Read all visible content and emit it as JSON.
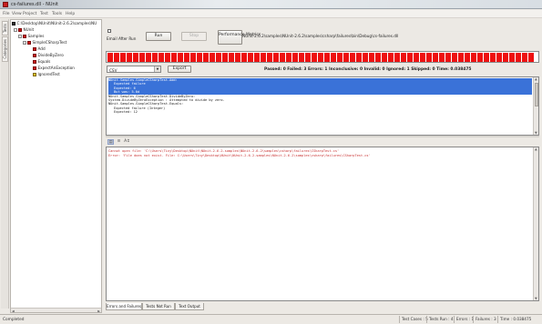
{
  "window": {
    "title": "cs-failures.dll - NUnit"
  },
  "menu": [
    "File",
    "View",
    "Project",
    "Test",
    "Tools",
    "Help"
  ],
  "side_tabs": [
    "Tests",
    "Categories"
  ],
  "tree": {
    "items": [
      {
        "label": "C:\\Desktop\\NUnit\\NUnit-2.6.2\\samples\\NU",
        "expander": ""
      },
      {
        "label": "NUnit",
        "expander": "-"
      },
      {
        "label": "Samples",
        "expander": "-"
      },
      {
        "label": "SimpleCSharpTest",
        "expander": "-"
      },
      {
        "label": "Add",
        "expander": ""
      },
      {
        "label": "DivideByZero",
        "expander": ""
      },
      {
        "label": "Equals",
        "expander": ""
      },
      {
        "label": "ExpectAnException",
        "expander": ""
      },
      {
        "label": "IgnoredTest",
        "expander": ""
      }
    ]
  },
  "controls": {
    "email_after_run": "Email After Run",
    "run_label": "Run",
    "stop_label": "Stop",
    "performance_label": "Performance Metrics",
    "path": "NUnit-2.6.2\\samples\\NUnit-2.6.2\\samples\\csharp\\failures\\bin\\Debug\\cs-failures.dll"
  },
  "format": {
    "selected": "CSV",
    "export_label": "Export"
  },
  "summary": "Passed: 0  Failed: 3  Errors: 1  Inconclusive: 0  Invalid: 0  Ignored: 1  Skipped: 0  Time: 0.038475",
  "results": [
    "NUnit.Samples.SimpleCSharpTest.Add:",
    "  Expected failure",
    "  Expected: 6",
    "  But was:  5.0d",
    "NUnit.Samples.SimpleCSharpTest.DivideByZero:",
    "System.DivideByZeroException : Attempted to divide by zero.",
    "NUnit.Samples.SimpleCSharpTest.Equals:",
    "  Expected failure (Integer)",
    "  Expected: 12"
  ],
  "output": [
    "Cannot open file: 'C:\\Users\\Tiny\\Desktop\\NUnit\\NUnit-2.6.2-samples\\NUnit-2.6.2\\samples\\csharp\\failures\\CSharpTest.cs'",
    "Error: 'File does not exist. File: C:\\Users\\Tiny\\Desktop\\NUnit\\NUnit-2.6.2-samples\\NUnit-2.6.2\\samples\\csharp\\failures\\CSharpTest.cs'"
  ],
  "bottom_tabs": [
    "Errors and Failures",
    "Tests Not Run",
    "Text Output"
  ],
  "status": {
    "text": "Completed",
    "test_cases": "Test Cases : 5",
    "tests_run": "Tests Run : 4",
    "errors": "Errors : 1",
    "failures": "Failures : 3",
    "time": "Time : 0.038475"
  },
  "colors": {
    "progress_fail": "#ee1010",
    "selection": "#3a72d8"
  },
  "progress_fraction": 1.0
}
